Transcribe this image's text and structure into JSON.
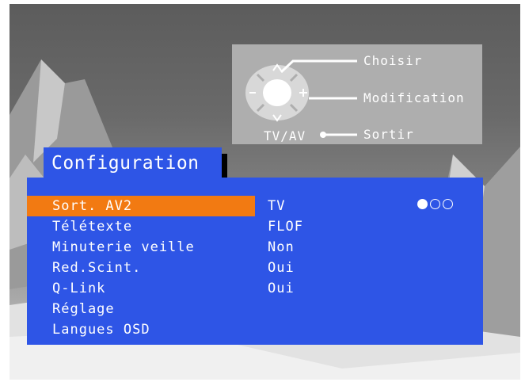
{
  "help": {
    "choose": "Choisir",
    "modify": "Modification",
    "exit": "Sortir",
    "tvav": "TV/AV"
  },
  "menu": {
    "title": "Configuration",
    "items": [
      {
        "label": "Sort. AV2",
        "value": "TV",
        "selected": true
      },
      {
        "label": "Télétexte",
        "value": "FLOF"
      },
      {
        "label": "Minuterie veille",
        "value": "Non"
      },
      {
        "label": "Red.Scint.",
        "value": "Oui"
      },
      {
        "label": "Q-Link",
        "value": "Oui"
      },
      {
        "label": "Réglage",
        "value": ""
      },
      {
        "label": "Langues OSD",
        "value": ""
      }
    ],
    "option_dots": {
      "count": 3,
      "active_index": 0
    }
  },
  "colors": {
    "menu_bg": "#2e55e6",
    "highlight": "#f27a12",
    "help_bg": "#aeaeae"
  }
}
